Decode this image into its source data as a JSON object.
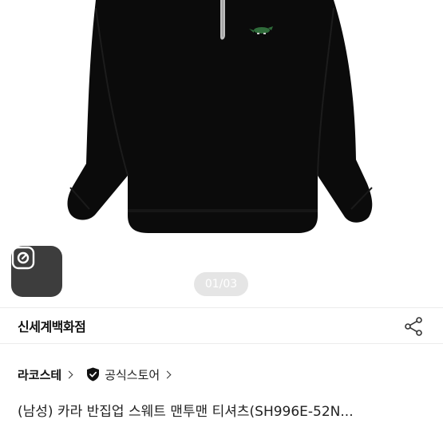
{
  "gallery": {
    "pager_text": "01/03",
    "icons": {
      "lens": "lens-camera-icon",
      "logo": "crocodile-logo-icon"
    }
  },
  "store": {
    "name": "신세계백화점",
    "share_icon": "share-icon"
  },
  "brand": {
    "name": "라코스테",
    "official_label": "공식스토어",
    "official_icon": "shield-check-icon"
  },
  "product": {
    "title": "(남성) 카라 반집업 스웨트 맨투맨 티셔츠(SH996E-52N..."
  },
  "colors": {
    "garment": "#0b0b0b",
    "zipper": "#bdbdbd",
    "logo_green": "#2f6b3a",
    "lens_button_bg": "#3d3d3d"
  }
}
